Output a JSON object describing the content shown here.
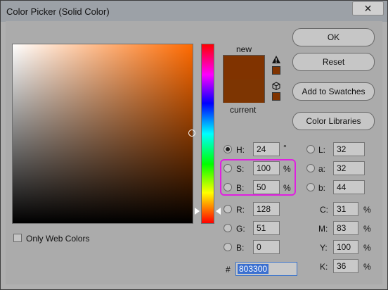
{
  "window": {
    "title": "Color Picker (Solid Color)"
  },
  "icons": {
    "close": "close-icon",
    "warning": "warning-triangle-icon",
    "websafe": "cube-icon"
  },
  "swatch": {
    "new_label": "new",
    "current_label": "current",
    "new_color": "#803300",
    "current_color": "#7d3502"
  },
  "buttons": {
    "ok": "OK",
    "reset": "Reset",
    "add_swatches": "Add to Swatches",
    "libraries": "Color Libraries"
  },
  "hsb": {
    "h": {
      "label": "H:",
      "value": "24",
      "unit": "°"
    },
    "s": {
      "label": "S:",
      "value": "100",
      "unit": "%"
    },
    "b": {
      "label": "B:",
      "value": "50",
      "unit": "%"
    }
  },
  "rgb": {
    "r": {
      "label": "R:",
      "value": "128"
    },
    "g": {
      "label": "G:",
      "value": "51"
    },
    "b": {
      "label": "B:",
      "value": "0"
    }
  },
  "lab": {
    "l": {
      "label": "L:",
      "value": "32"
    },
    "a": {
      "label": "a:",
      "value": "32"
    },
    "b": {
      "label": "b:",
      "value": "44"
    }
  },
  "cmyk": {
    "c": {
      "label": "C:",
      "value": "31",
      "unit": "%"
    },
    "m": {
      "label": "M:",
      "value": "83",
      "unit": "%"
    },
    "y": {
      "label": "Y:",
      "value": "100",
      "unit": "%"
    },
    "k": {
      "label": "K:",
      "value": "36",
      "unit": "%"
    }
  },
  "hex": {
    "label": "#",
    "value": "803300"
  },
  "options": {
    "only_web_colors": "Only Web Colors"
  }
}
